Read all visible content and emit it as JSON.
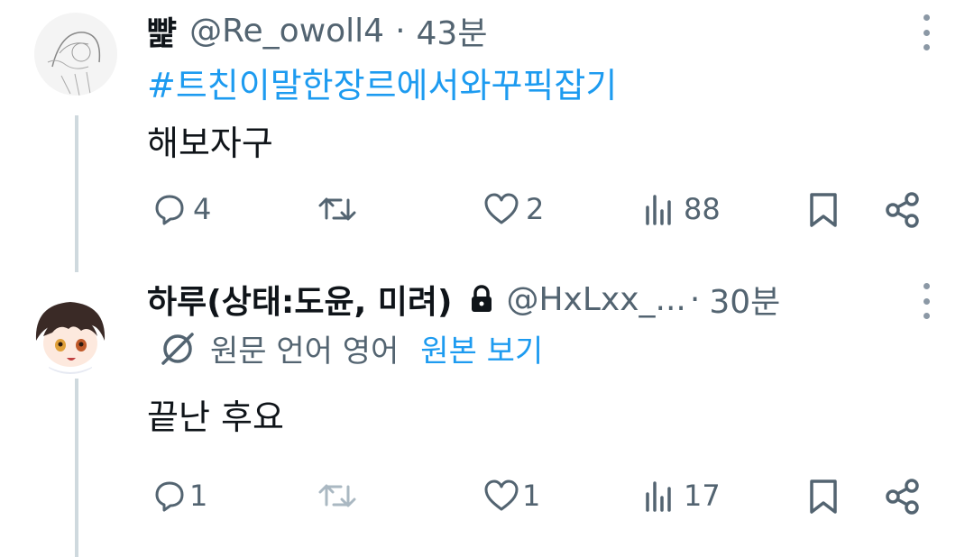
{
  "tweets": [
    {
      "display_name": "뺥",
      "handle": "@Re_owoll4",
      "separator": "·",
      "time": "43분",
      "hashtag": "#트친이말한장르에서와꾸픽잡기",
      "text": "해보자구",
      "actions": {
        "replies": "4",
        "retweets": "",
        "likes": "2",
        "views": "88"
      }
    },
    {
      "display_name": "하루(상태:도윤, 미려)",
      "handle": "@HxLxx_...",
      "separator": "·",
      "time": "30분",
      "translation_notice": "원문 언어 영어",
      "show_original": "원본 보기",
      "text": "끝난 후요",
      "actions": {
        "replies": "1",
        "retweets": "",
        "likes": "1",
        "views": "17"
      }
    }
  ],
  "colors": {
    "link": "#1d9bf0",
    "secondary_text": "#536471",
    "thread_line": "#cfd9de",
    "icon": "#536471",
    "icon_disabled": "#aab8c2"
  },
  "icons": [
    "reply-icon",
    "retweet-icon",
    "like-icon",
    "views-icon",
    "bookmark-icon",
    "share-icon",
    "lock-icon",
    "globe-slash-icon",
    "more-icon"
  ]
}
